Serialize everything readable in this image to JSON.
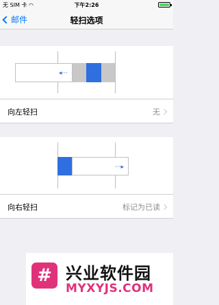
{
  "status_bar": {
    "carrier": "无 SIM 卡",
    "wifi": "wifi-icon",
    "time": "下午2:26",
    "battery": "battery-icon"
  },
  "nav": {
    "back_label": "邮件",
    "title": "轻扫选项"
  },
  "swipe_left": {
    "label": "向左轻扫",
    "value": "无",
    "arrow": "◂···"
  },
  "swipe_right": {
    "label": "向右轻扫",
    "value": "标记为已读",
    "arrow": "···▸"
  },
  "watermark": {
    "logo": "#",
    "title": "兴业软件园",
    "subtitle": "MYXYJS.COM"
  },
  "colors": {
    "accent": "#007aff",
    "swipe_blue": "#2f6fe0",
    "swipe_gray": "#c8c8c8",
    "watermark_pink": "#e0327a"
  }
}
